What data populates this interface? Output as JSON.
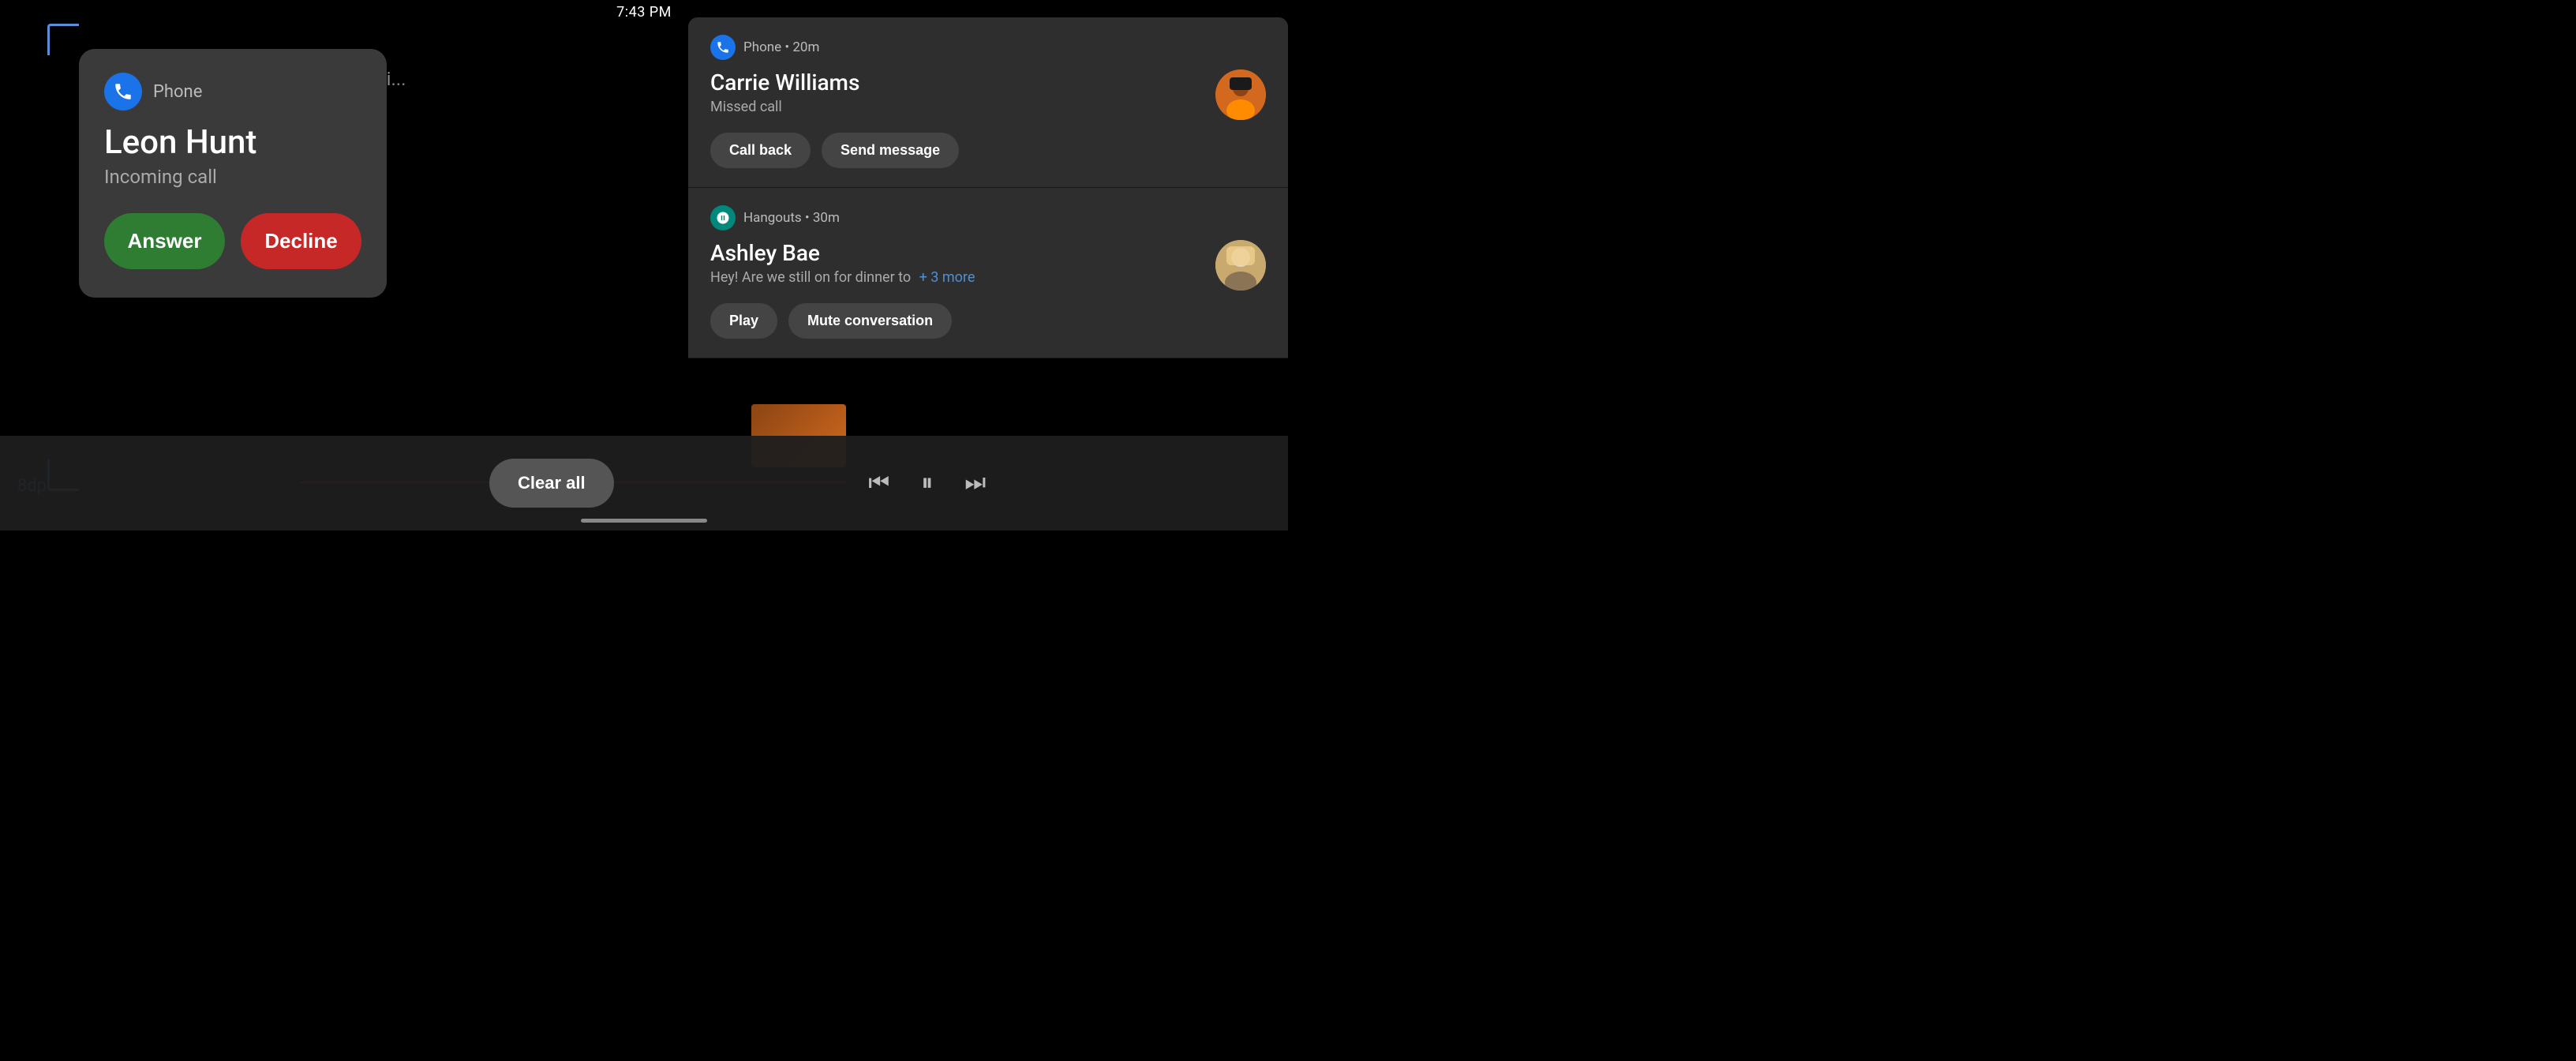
{
  "statusBar": {
    "time": "7:43 PM"
  },
  "dpLabel": "8dp",
  "incomingCall": {
    "appName": "Phone",
    "callerName": "Leon Hunt",
    "callStatus": "Incoming call",
    "answerLabel": "Answer",
    "declineLabel": "Decline"
  },
  "notifications": [
    {
      "id": "phone-notification",
      "appName": "Phone",
      "appTime": "Phone • 20m",
      "contactName": "Carrie Williams",
      "subtitle": "Missed call",
      "actions": [
        "Call back",
        "Send message"
      ],
      "hasAvatar": true
    },
    {
      "id": "hangouts-notification",
      "appName": "Hangouts",
      "appTime": "Hangouts • 30m",
      "contactName": "Ashley Bae",
      "subtitle": "Hey! Are we still on for dinner to",
      "moreCount": "+ 3 more",
      "actions": [
        "Play",
        "Mute conversation"
      ],
      "hasAvatar": true
    }
  ],
  "bottomBar": {
    "clearAllLabel": "Clear all"
  },
  "mediaControls": {
    "prevLabel": "⏮",
    "pauseLabel": "⏸",
    "nextLabel": "⏭"
  }
}
